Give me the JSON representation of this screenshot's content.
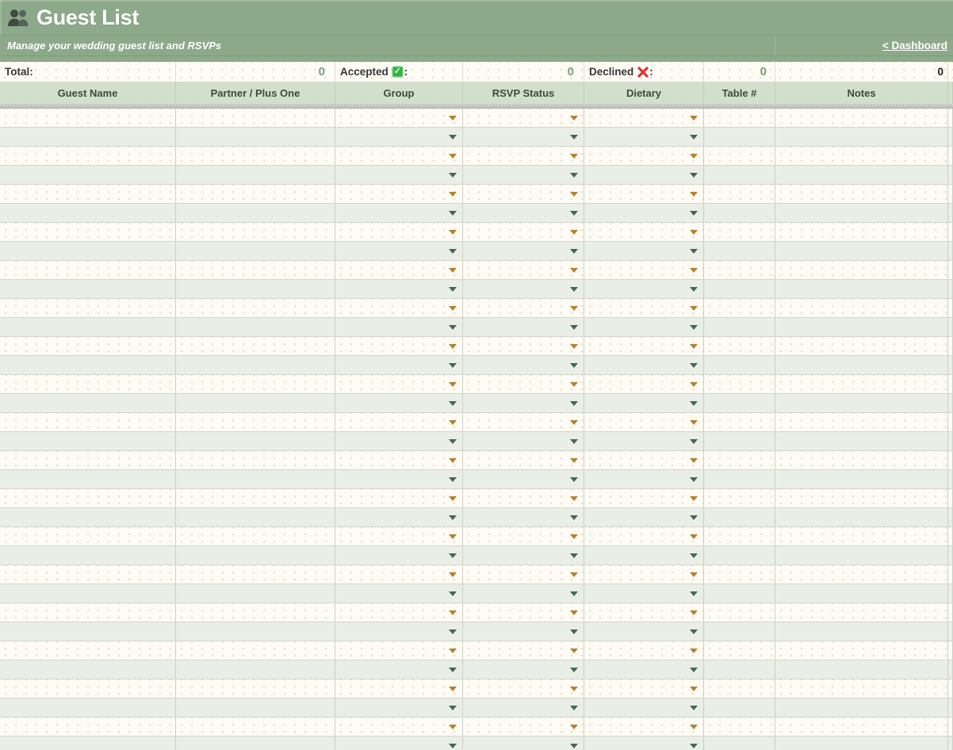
{
  "app": {
    "title": "Guest List",
    "subtitle": "Manage your wedding guest list and RSVPs"
  },
  "nav": {
    "dashboard_link": "< Dashboard"
  },
  "icons": {
    "check": "✓",
    "title_icon": "people-icon",
    "accepted_icon": "green-check-emoji",
    "declined_icon": "red-cross-emoji"
  },
  "stats": {
    "total": {
      "label": "Total:",
      "value": "0"
    },
    "accepted": {
      "label": "Accepted",
      "suffix": ":",
      "value": "0"
    },
    "declined": {
      "label": "Declined",
      "suffix": ":",
      "value": "0"
    },
    "extra_value": "0"
  },
  "table": {
    "columns": [
      {
        "label": "Guest Name",
        "dropdown": false
      },
      {
        "label": "Partner / Plus One",
        "dropdown": false
      },
      {
        "label": "Group",
        "dropdown": true
      },
      {
        "label": "RSVP Status",
        "dropdown": true
      },
      {
        "label": "Dietary",
        "dropdown": true
      },
      {
        "label": "Table #",
        "dropdown": false
      },
      {
        "label": "Notes",
        "dropdown": false
      }
    ],
    "row_count": 34,
    "rows_are_empty": true
  },
  "colors": {
    "header_green": "#8CA98A",
    "header_green_line": "#7D9A7B",
    "column_header_bg": "#D2E0CB",
    "row_cream": "#FDFBF3",
    "row_green": "#E9EFE6",
    "gridline": "#CCD0C6",
    "row_line": "#D3D6CC",
    "divider_gray": "#C2C5BF",
    "arrow_orange": "#B5812F",
    "arrow_green": "#44694B",
    "stat_number_green": "#7BA274",
    "text_dark": "#373737",
    "header_text": "#3C4C3A",
    "check_green": "#2FB344",
    "cross_red": "#E03131",
    "dot": "#E0DDCE"
  }
}
